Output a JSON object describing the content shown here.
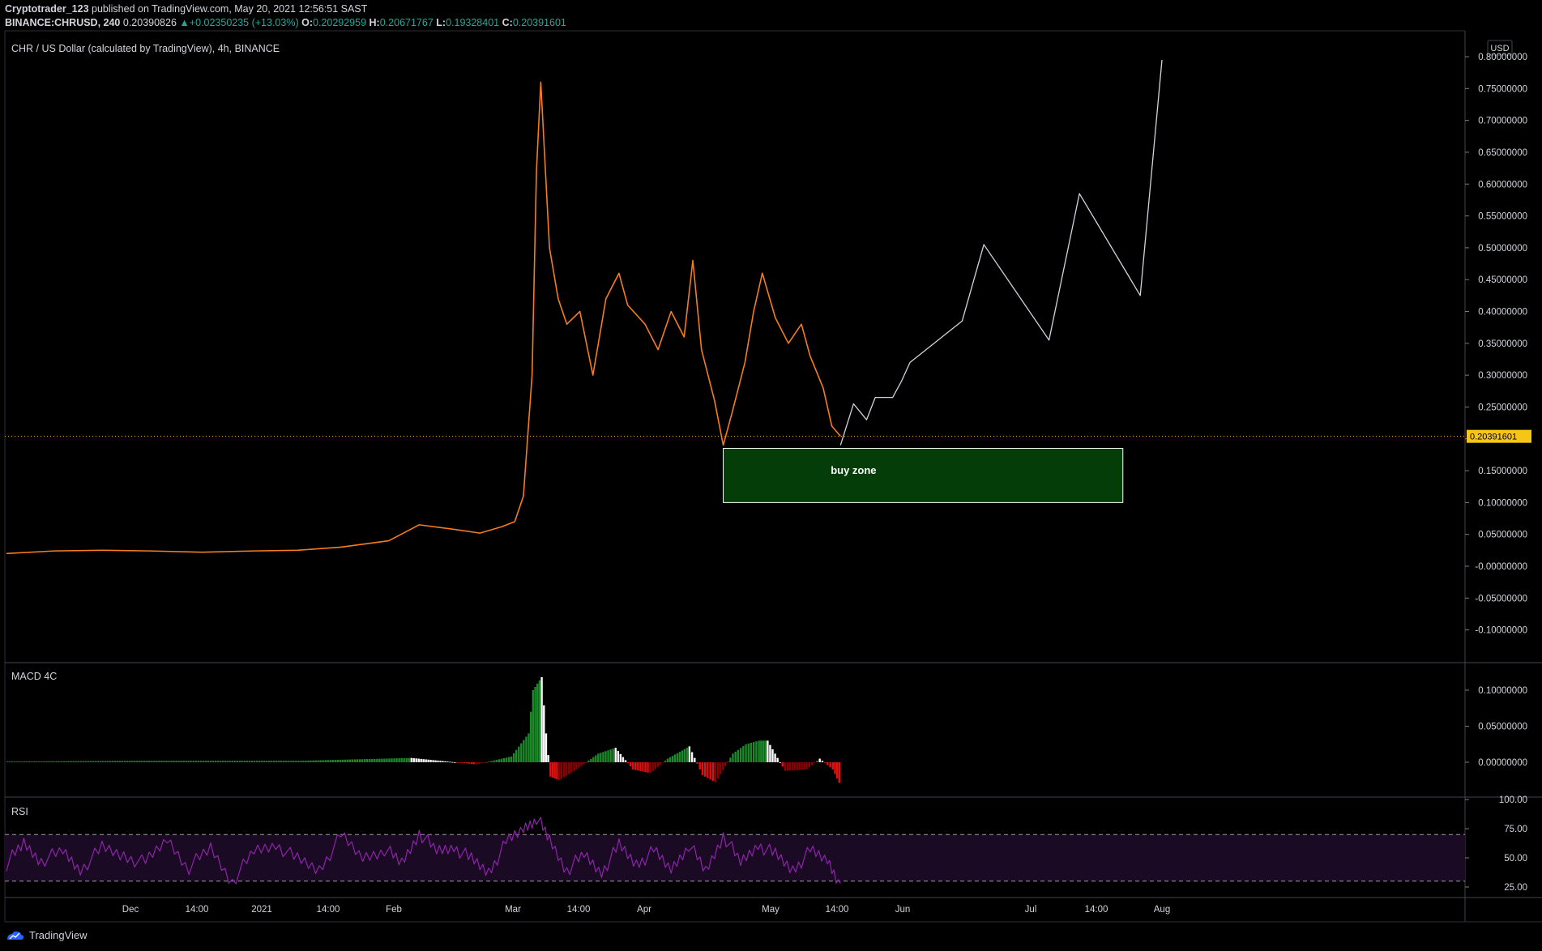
{
  "header": {
    "publisher": "Cryptotrader_123",
    "published_text": "published on TradingView.com, May 20, 2021 12:56:51 SAST",
    "symbol": "BINANCE:CHRUSD, 240",
    "last_price": "0.20390826",
    "change": "+0.02350235 (+13.03%)",
    "o_label": "O:",
    "o_value": "0.20292959",
    "h_label": "H:",
    "h_value": "0.20671767",
    "l_label": "L:",
    "l_value": "0.19328401",
    "c_label": "C:",
    "c_value": "0.20391601"
  },
  "footer": {
    "brand": "TradingView"
  },
  "colors": {
    "background": "#000000",
    "price_line": "#f57c1f",
    "buy_zone_fill": "#053d08",
    "macd_pos": "#1b8a2a",
    "macd_neg": "#e01010",
    "rsi_line": "#8e24aa",
    "rsi_band": "#1a0a24",
    "last_price_badge": "#f5c518"
  },
  "chart_data": [
    {
      "type": "line",
      "title": "CHR / US Dollar (calculated by TradingView), 4h, BINANCE",
      "currency_label": "USD",
      "y_ticks": [
        "0.80000000",
        "0.75000000",
        "0.70000000",
        "0.65000000",
        "0.60000000",
        "0.55000000",
        "0.50000000",
        "0.45000000",
        "0.40000000",
        "0.35000000",
        "0.30000000",
        "0.25000000",
        "0.20000000",
        "0.15000000",
        "0.10000000",
        "0.05000000",
        "-0.00000000",
        "-0.05000000",
        "-0.10000000"
      ],
      "y_tick_values": [
        0.8,
        0.75,
        0.7,
        0.65,
        0.6,
        0.55,
        0.5,
        0.45,
        0.4,
        0.35,
        0.3,
        0.25,
        0.2,
        0.15,
        0.1,
        0.05,
        0,
        -0.05,
        -0.1
      ],
      "ylim": [
        -0.12,
        0.8
      ],
      "x_ticks": [
        "Dec",
        "14:00",
        "2021",
        "14:00",
        "Feb",
        "Mar",
        "14:00",
        "Apr",
        "May",
        "14:00",
        "Jun",
        "Jul",
        "14:00",
        "Aug"
      ],
      "last_price_label": "0.20391601",
      "last_price": 0.20391601,
      "price_series": {
        "name": "CHRUSD",
        "x": [
          "2020-11-09",
          "2020-11-20",
          "2020-12-01",
          "2020-12-12",
          "2020-12-24",
          "2021-01-05",
          "2021-01-15",
          "2021-01-25",
          "2021-02-05",
          "2021-02-12",
          "2021-02-20",
          "2021-02-26",
          "2021-03-03",
          "2021-03-06",
          "2021-03-08",
          "2021-03-10",
          "2021-03-11",
          "2021-03-12",
          "2021-03-14",
          "2021-03-16",
          "2021-03-18",
          "2021-03-21",
          "2021-03-24",
          "2021-03-27",
          "2021-03-30",
          "2021-04-01",
          "2021-04-05",
          "2021-04-08",
          "2021-04-11",
          "2021-04-14",
          "2021-04-16",
          "2021-04-18",
          "2021-04-21",
          "2021-04-23",
          "2021-04-25",
          "2021-04-28",
          "2021-04-30",
          "2021-05-02",
          "2021-05-05",
          "2021-05-08",
          "2021-05-11",
          "2021-05-13",
          "2021-05-16",
          "2021-05-18",
          "2021-05-20"
        ],
        "y": [
          0.02,
          0.024,
          0.025,
          0.024,
          0.022,
          0.024,
          0.025,
          0.03,
          0.04,
          0.065,
          0.058,
          0.052,
          0.062,
          0.07,
          0.11,
          0.3,
          0.62,
          0.76,
          0.5,
          0.42,
          0.38,
          0.4,
          0.3,
          0.42,
          0.46,
          0.41,
          0.38,
          0.34,
          0.4,
          0.36,
          0.48,
          0.34,
          0.26,
          0.19,
          0.24,
          0.32,
          0.4,
          0.46,
          0.39,
          0.35,
          0.38,
          0.33,
          0.28,
          0.22,
          0.204
        ]
      },
      "projection": {
        "x": [
          "2021-05-20",
          "2021-05-23",
          "2021-05-26",
          "2021-05-28",
          "2021-06-01",
          "2021-06-03",
          "2021-06-05",
          "2021-06-17",
          "2021-06-22",
          "2021-07-07",
          "2021-07-14",
          "2021-07-28",
          "2021-08-02"
        ],
        "y": [
          0.19,
          0.255,
          0.23,
          0.265,
          0.265,
          0.29,
          0.32,
          0.385,
          0.505,
          0.355,
          0.585,
          0.425,
          0.795
        ]
      },
      "annotations": [
        {
          "type": "rectangle",
          "label": "buy zone",
          "x_start": "2021-04-23",
          "x_end": "2021-07-24",
          "y_start": 0.1,
          "y_end": 0.185
        }
      ]
    },
    {
      "type": "bar",
      "title": "MACD 4C",
      "y_ticks": [
        "0.10000000",
        "0.05000000",
        "0.00000000"
      ],
      "y_tick_values": [
        0.1,
        0.05,
        0
      ],
      "ylim": [
        -0.04,
        0.13
      ],
      "x": [
        "2020-11-09",
        "2020-12-10",
        "2021-01-15",
        "2021-02-10",
        "2021-02-25",
        "2021-03-05",
        "2021-03-09",
        "2021-03-10",
        "2021-03-12",
        "2021-03-13",
        "2021-03-14",
        "2021-03-16",
        "2021-03-20",
        "2021-03-25",
        "2021-03-29",
        "2021-04-02",
        "2021-04-06",
        "2021-04-10",
        "2021-04-15",
        "2021-04-18",
        "2021-04-21",
        "2021-04-25",
        "2021-04-28",
        "2021-05-01",
        "2021-05-03",
        "2021-05-07",
        "2021-05-12",
        "2021-05-15",
        "2021-05-18",
        "2021-05-20"
      ],
      "values": [
        0.001,
        0.002,
        0.002,
        0.006,
        -0.003,
        0.008,
        0.04,
        0.1,
        0.118,
        0.04,
        -0.02,
        -0.025,
        -0.01,
        0.012,
        0.02,
        -0.01,
        -0.015,
        0.005,
        0.022,
        -0.018,
        -0.028,
        0.012,
        0.025,
        0.03,
        0.03,
        -0.012,
        -0.01,
        0.005,
        -0.01,
        -0.035
      ]
    },
    {
      "type": "line",
      "title": "RSI",
      "y_ticks": [
        "100.00",
        "75.00",
        "50.00",
        "25.00"
      ],
      "y_tick_values": [
        100,
        75,
        50,
        25
      ],
      "ylim": [
        20,
        100
      ],
      "bands": [
        70,
        30
      ],
      "x": [
        "2020-11-09",
        "2020-11-13",
        "2020-11-17",
        "2020-11-22",
        "2020-11-26",
        "2020-12-01",
        "2020-12-06",
        "2020-12-11",
        "2020-12-16",
        "2020-12-21",
        "2020-12-26",
        "2020-12-31",
        "2021-01-05",
        "2021-01-10",
        "2021-01-15",
        "2021-01-20",
        "2021-01-25",
        "2021-01-30",
        "2021-02-04",
        "2021-02-08",
        "2021-02-12",
        "2021-02-16",
        "2021-02-20",
        "2021-02-24",
        "2021-02-28",
        "2021-03-04",
        "2021-03-08",
        "2021-03-11",
        "2021-03-14",
        "2021-03-18",
        "2021-03-22",
        "2021-03-26",
        "2021-03-30",
        "2021-04-03",
        "2021-04-07",
        "2021-04-11",
        "2021-04-15",
        "2021-04-19",
        "2021-04-23",
        "2021-04-27",
        "2021-05-01",
        "2021-05-05",
        "2021-05-09",
        "2021-05-13",
        "2021-05-17",
        "2021-05-20"
      ],
      "values": [
        45,
        62,
        48,
        55,
        40,
        58,
        52,
        45,
        66,
        42,
        58,
        30,
        55,
        62,
        48,
        40,
        68,
        50,
        58,
        45,
        72,
        55,
        60,
        48,
        38,
        62,
        75,
        85,
        65,
        40,
        52,
        38,
        60,
        45,
        55,
        40,
        62,
        38,
        70,
        45,
        62,
        52,
        40,
        55,
        48,
        28
      ]
    }
  ]
}
